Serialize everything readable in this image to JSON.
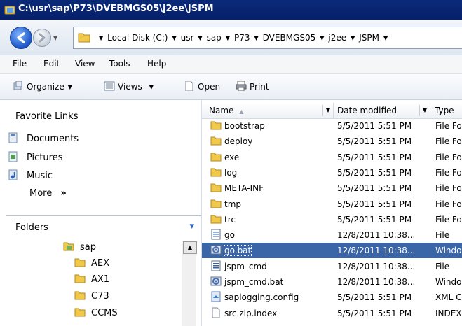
{
  "window": {
    "title": "C:\\usr\\sap\\P73\\DVEBMGS05\\j2ee\\JSPM"
  },
  "address": {
    "crumbs": [
      "Local Disk (C:)",
      "usr",
      "sap",
      "P73",
      "DVEBMGS05",
      "j2ee",
      "JSPM"
    ]
  },
  "menu": {
    "file": "File",
    "edit": "Edit",
    "view": "View",
    "tools": "Tools",
    "help": "Help"
  },
  "toolbar": {
    "organize": "Organize",
    "views": "Views",
    "open": "Open",
    "print": "Print"
  },
  "favorites": {
    "title": "Favorite Links",
    "items": [
      "Documents",
      "Pictures",
      "Music"
    ],
    "more": "More",
    "more_glyph": "»"
  },
  "folders": {
    "title": "Folders",
    "tree": [
      {
        "label": "sap"
      },
      {
        "label": "AEX"
      },
      {
        "label": "AX1"
      },
      {
        "label": "C73"
      },
      {
        "label": "CCMS"
      }
    ]
  },
  "columns": {
    "name": "Name",
    "date": "Date modified",
    "type": "Type"
  },
  "files": [
    {
      "name": "bootstrap",
      "date": "5/5/2011 5:51 PM",
      "type": "File Fo",
      "icon": "folder-icon"
    },
    {
      "name": "deploy",
      "date": "5/5/2011 5:51 PM",
      "type": "File Fo",
      "icon": "folder-icon"
    },
    {
      "name": "exe",
      "date": "5/5/2011 5:51 PM",
      "type": "File Fo",
      "icon": "folder-icon"
    },
    {
      "name": "log",
      "date": "5/5/2011 5:51 PM",
      "type": "File Fo",
      "icon": "folder-icon"
    },
    {
      "name": "META-INF",
      "date": "5/5/2011 5:51 PM",
      "type": "File Fo",
      "icon": "folder-icon"
    },
    {
      "name": "tmp",
      "date": "5/5/2011 5:51 PM",
      "type": "File Fo",
      "icon": "folder-icon"
    },
    {
      "name": "trc",
      "date": "5/5/2011 5:51 PM",
      "type": "File Fo",
      "icon": "folder-icon"
    },
    {
      "name": "go",
      "date": "12/8/2011 10:38...",
      "type": "File",
      "icon": "script-file-icon"
    },
    {
      "name": "go.bat",
      "date": "12/8/2011 10:38...",
      "type": "Windo",
      "icon": "batch-file-icon",
      "selected": true
    },
    {
      "name": "jspm_cmd",
      "date": "12/8/2011 10:38...",
      "type": "File",
      "icon": "script-file-icon"
    },
    {
      "name": "jspm_cmd.bat",
      "date": "12/8/2011 10:38...",
      "type": "Windo",
      "icon": "batch-file-icon"
    },
    {
      "name": "saplogging.config",
      "date": "5/5/2011 5:51 PM",
      "type": "XML C",
      "icon": "config-file-icon"
    },
    {
      "name": "src.zip.index",
      "date": "5/5/2011 5:51 PM",
      "type": "INDEX",
      "icon": "document-icon"
    }
  ],
  "colors": {
    "selection": "#3a66a8",
    "titlebar": "#0a2a78",
    "folder": "#e8b73c"
  }
}
